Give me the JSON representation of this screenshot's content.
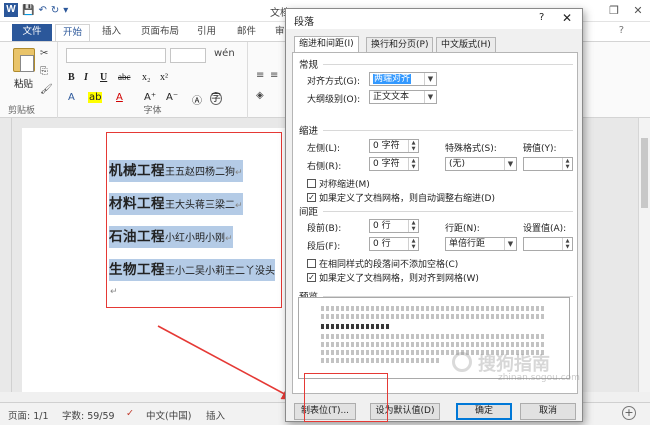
{
  "window": {
    "title": "文档1 - Microsoft Word"
  },
  "ribbon_tabs": [
    "文件",
    "开始",
    "插入",
    "页面布局",
    "引用",
    "邮件",
    "审"
  ],
  "ribbon": {
    "paste_label": "粘贴",
    "clipboard_label": "剪贴板",
    "font_label": "字体",
    "bold": "B",
    "italic": "I",
    "underline": "U",
    "strike": "abc",
    "subscript": "x₂",
    "superscript": "x²",
    "grow": "A⁺",
    "shrink": "A⁻",
    "wen": "wén",
    "a_icon": "A"
  },
  "document": {
    "lines": [
      {
        "title": "机械工程",
        "names": "王五赵四杨二狗"
      },
      {
        "title": "材料工程",
        "names": "王大头蒋三梁二"
      },
      {
        "title": "石油工程",
        "names": "小红小明小刚"
      },
      {
        "title": "生物工程",
        "names": "王小二吴小莉王二丫没头"
      }
    ],
    "para_mark": "↵"
  },
  "status": {
    "page": "页面: 1/1",
    "words": "字数: 59/59",
    "lang": "中文(中国)",
    "mode": "插入"
  },
  "dialog": {
    "title": "段落",
    "help": "?",
    "close": "✕",
    "tabs": [
      "缩进和间距(I)",
      "换行和分页(P)",
      "中文版式(H)"
    ],
    "general": {
      "heading": "常规",
      "align_label": "对齐方式(G):",
      "align_value": "两端对齐",
      "outline_label": "大纲级别(O):",
      "outline_value": "正文文本"
    },
    "indent": {
      "heading": "缩进",
      "left_label": "左侧(L):",
      "left_value": "0 字符",
      "right_label": "右侧(R):",
      "right_value": "0 字符",
      "special_label": "特殊格式(S):",
      "special_value": "(无)",
      "by_label": "磅值(Y):",
      "by_value": "",
      "mirror": "对称缩进(M)",
      "auto_adjust": "如果定义了文档网格，则自动调整右缩进(D)"
    },
    "spacing": {
      "heading": "间距",
      "before_label": "段前(B):",
      "before_value": "0 行",
      "after_label": "段后(F):",
      "after_value": "0 行",
      "line_label": "行距(N):",
      "line_value": "单倍行距",
      "at_label": "设置值(A):",
      "at_value": "",
      "no_space": "在相同样式的段落间不添加空格(C)",
      "snap_grid": "如果定义了文档网格，则对齐到网格(W)"
    },
    "preview_heading": "预览",
    "buttons": {
      "tabs": "制表位(T)...",
      "set_default": "设为默认值(D)",
      "ok": "确定",
      "cancel": "取消"
    }
  },
  "watermark": {
    "main": "搜狗指南",
    "sub": "zhinan.sogou.com"
  }
}
